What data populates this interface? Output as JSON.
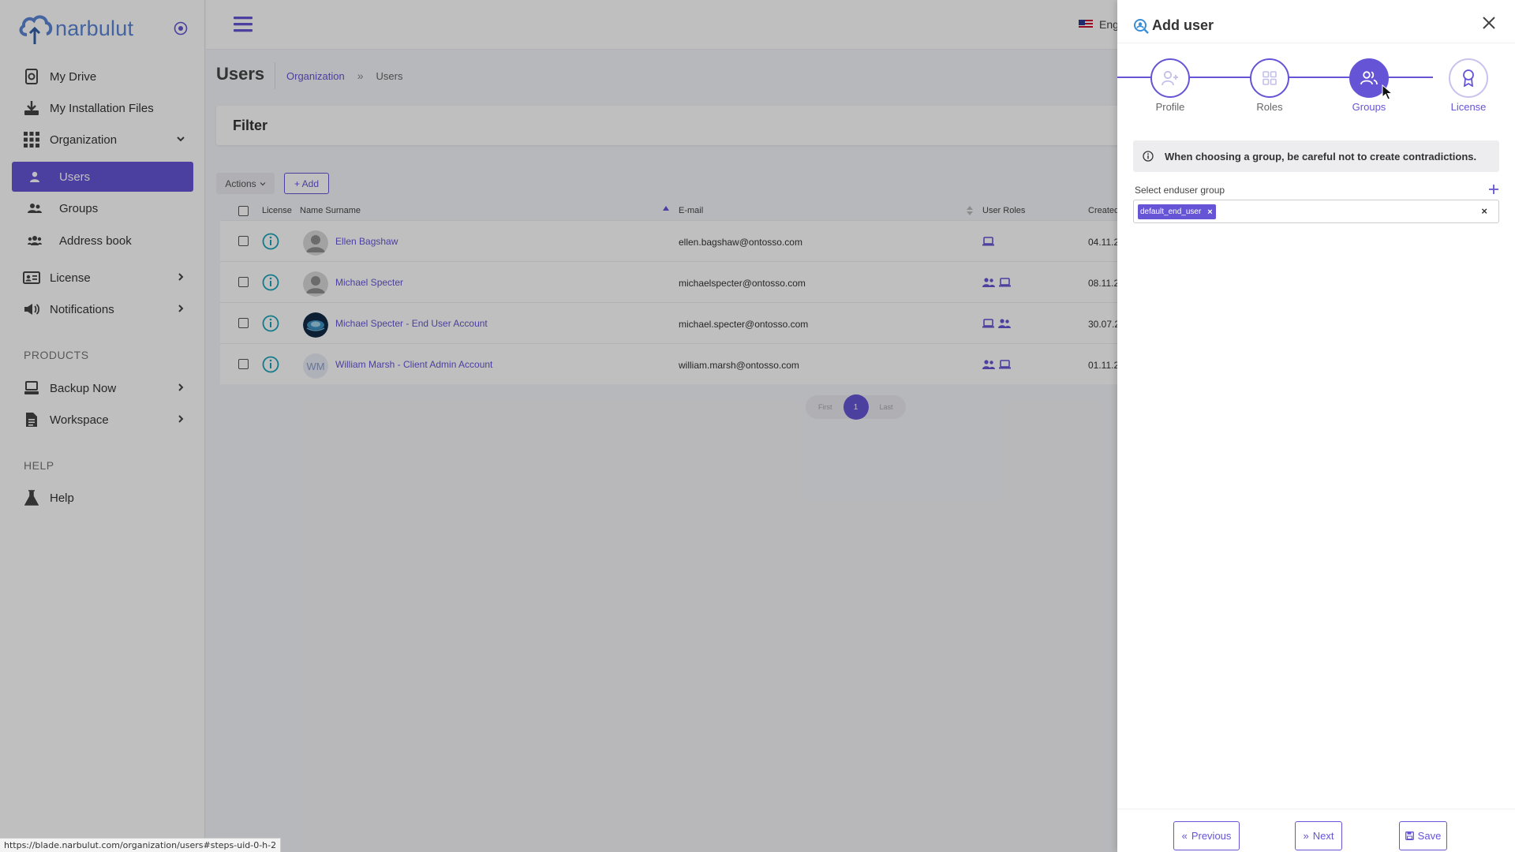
{
  "app": {
    "logo_text": "narbulut"
  },
  "sidebar": {
    "items": [
      {
        "label": "My Drive",
        "icon": "drive-icon"
      },
      {
        "label": "My Installation Files",
        "icon": "download-icon"
      },
      {
        "label": "Organization",
        "icon": "grid-icon"
      },
      {
        "label": "Users",
        "icon": "user-icon"
      },
      {
        "label": "Groups",
        "icon": "users-icon"
      },
      {
        "label": "Address book",
        "icon": "address-book-icon"
      },
      {
        "label": "License",
        "icon": "id-card-icon"
      },
      {
        "label": "Notifications",
        "icon": "megaphone-icon"
      },
      {
        "label": "Backup Now",
        "icon": "server-icon"
      },
      {
        "label": "Workspace",
        "icon": "file-icon"
      },
      {
        "label": "Help",
        "icon": "flask-icon"
      }
    ],
    "sections": {
      "products": "PRODUCTS",
      "help": "HELP"
    }
  },
  "topbar": {
    "language": "Eng"
  },
  "page": {
    "title": "Users",
    "breadcrumb": {
      "parent": "Organization",
      "separator": "»",
      "current": "Users"
    }
  },
  "filter": {
    "title": "Filter"
  },
  "toolbar": {
    "actions_label": "Actions",
    "add_label": "+ Add"
  },
  "table": {
    "headers": {
      "license": "License",
      "name": "Name Surname",
      "email": "E-mail",
      "roles": "User Roles",
      "created": "Created"
    },
    "rows": [
      {
        "name": "Ellen Bagshaw",
        "email": "ellen.bagshaw@ontosso.com",
        "created": "04.11.2",
        "avatar": "default",
        "roles": [
          "laptop-icon"
        ]
      },
      {
        "name": "Michael Specter",
        "email": "michaelspecter@ontosso.com",
        "created": "08.11.2",
        "avatar": "default",
        "roles": [
          "users-icon",
          "laptop-icon"
        ]
      },
      {
        "name": "Michael Specter - End User Account",
        "email": "michael.specter@ontosso.com",
        "created": "30.07.2",
        "avatar": "photo",
        "roles": [
          "laptop-icon",
          "users-icon"
        ]
      },
      {
        "name": "William Marsh - Client Admin Account",
        "email": "william.marsh@ontosso.com",
        "created": "01.11.2",
        "avatar": "WM",
        "roles": [
          "users-icon",
          "laptop-icon"
        ]
      }
    ]
  },
  "pagination": {
    "first": "First",
    "page": "1",
    "last": "Last"
  },
  "status_bar": {
    "url": "https://blade.narbulut.com/organization/users#steps-uid-0-h-2"
  },
  "panel": {
    "title": "Add user",
    "steps": [
      {
        "label": "Profile",
        "icon": "user-plus-icon"
      },
      {
        "label": "Roles",
        "icon": "grid-icon"
      },
      {
        "label": "Groups",
        "icon": "users-icon",
        "active": true
      },
      {
        "label": "License",
        "icon": "award-icon"
      }
    ],
    "notice": "When choosing a group, be careful not to create contradictions.",
    "field_label": "Select enduser group",
    "selected_tag": "default_end_user",
    "tag_remove": "×",
    "clear": "×",
    "buttons": {
      "previous": "Previous",
      "next": "Next",
      "save": "Save"
    }
  },
  "colors": {
    "accent": "#6554d6",
    "logo": "#5a86d6",
    "info": "#1aa3b8"
  }
}
